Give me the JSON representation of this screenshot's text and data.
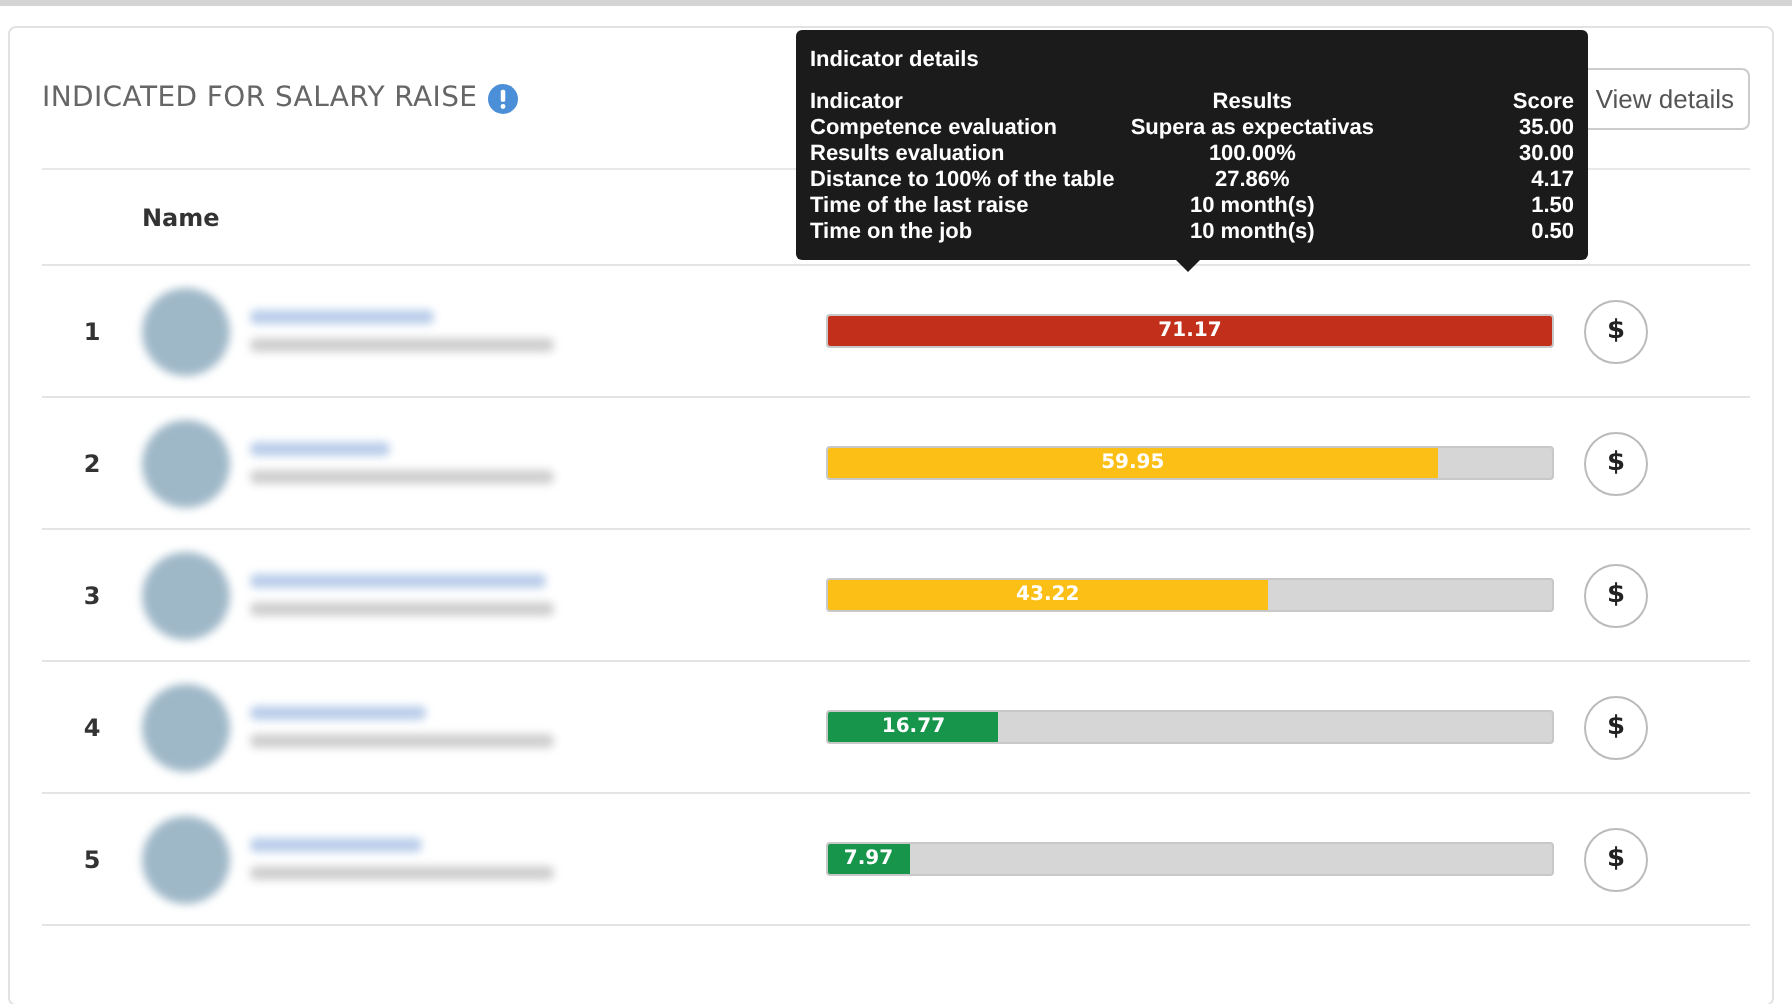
{
  "panel": {
    "title": "INDICATED FOR SALARY RAISE",
    "buttons": [
      "View details"
    ]
  },
  "table": {
    "columns": [
      "Name"
    ],
    "rows": [
      {
        "rank": "1",
        "score": "71.17",
        "level": 1,
        "color": "#c2301c"
      },
      {
        "rank": "2",
        "score": "59.95",
        "level": 0.842,
        "color": "#fbbf16"
      },
      {
        "rank": "3",
        "score": "43.22",
        "level": 0.607,
        "color": "#fbbf16"
      },
      {
        "rank": "4",
        "score": "16.77",
        "level": 0.236,
        "color": "#17954a"
      },
      {
        "rank": "5",
        "score": "7.97",
        "level": 0.112,
        "color": "#17954a"
      }
    ],
    "action": "$"
  },
  "tooltip": {
    "title": "Indicator details",
    "columns": [
      "Indicator",
      "Results",
      "Score"
    ],
    "rows": [
      [
        "Competence evaluation",
        "Supera as expectativas",
        "35.00"
      ],
      [
        "Results evaluation",
        "100.00%",
        "30.00"
      ],
      [
        "Distance to 100% of the table",
        "27.86%",
        "4.17"
      ],
      [
        "Time of the last raise",
        "10 month(s)",
        "1.50"
      ],
      [
        "Time on the job",
        "10 month(s)",
        "0.50"
      ]
    ]
  }
}
